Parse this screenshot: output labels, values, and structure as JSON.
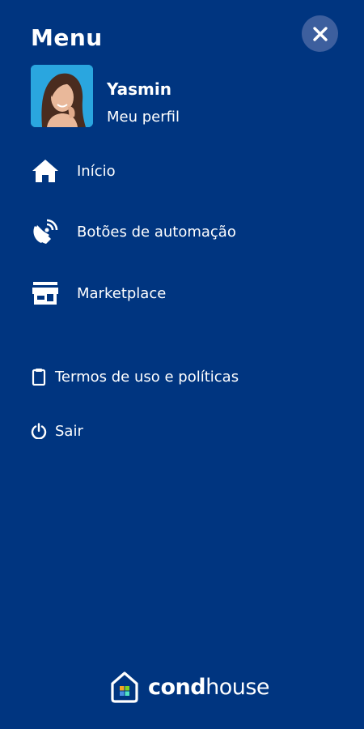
{
  "menu": {
    "title": "Menu"
  },
  "profile": {
    "name": "Yasmin",
    "link_label": "Meu perfil"
  },
  "nav": {
    "items": [
      {
        "label": "Início",
        "icon": "home-icon"
      },
      {
        "label": "Botões de automação",
        "icon": "satellite-dish-icon"
      },
      {
        "label": "Marketplace",
        "icon": "storefront-icon"
      }
    ]
  },
  "secondary": {
    "items": [
      {
        "label": "Termos de uso e políticas",
        "icon": "clipboard-icon"
      },
      {
        "label": "Sair",
        "icon": "power-icon"
      }
    ]
  },
  "brand": {
    "bold": "cond",
    "regular": "house"
  },
  "colors": {
    "background": "#003580",
    "close_button": "#3d5f9e",
    "text": "#ffffff"
  }
}
